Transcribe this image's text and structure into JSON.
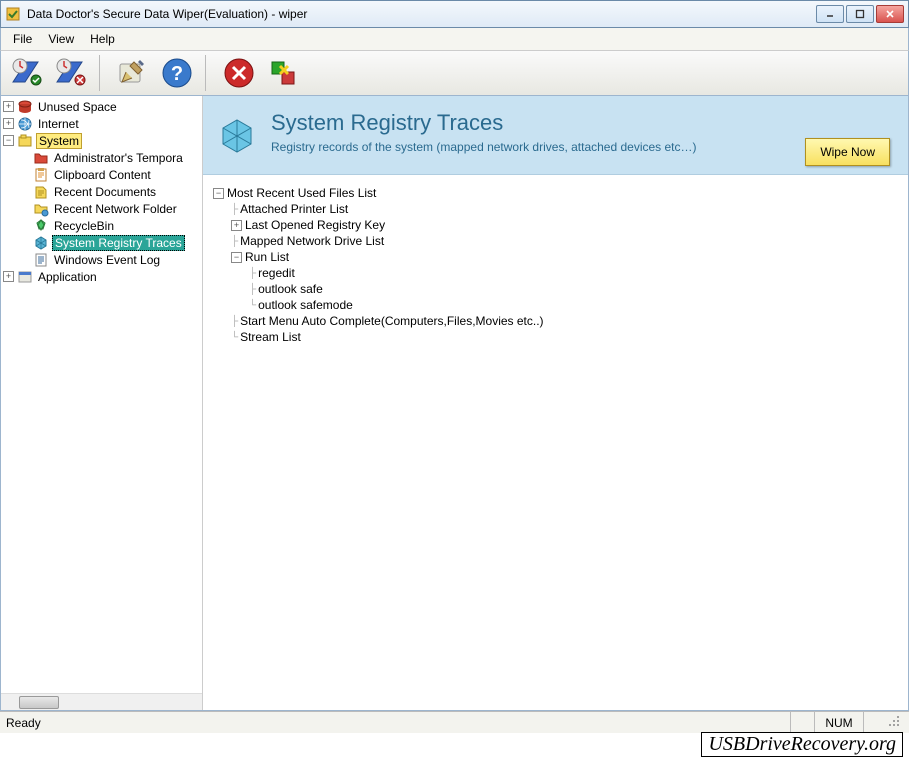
{
  "window": {
    "title": "Data Doctor's Secure Data Wiper(Evaluation) - wiper"
  },
  "menu": {
    "file": "File",
    "view": "View",
    "help": "Help"
  },
  "sidebar": {
    "unused_space": "Unused Space",
    "internet": "Internet",
    "system": "System",
    "system_children": {
      "admin_temp": "Administrator's Tempora",
      "clipboard": "Clipboard Content",
      "recent_docs": "Recent Documents",
      "recent_net": "Recent Network Folder",
      "recyclebin": "RecycleBin",
      "registry_traces": "System Registry Traces",
      "event_log": "Windows Event Log"
    },
    "application": "Application"
  },
  "header": {
    "title": "System Registry Traces",
    "subtitle": "Registry records of the system (mapped network drives, attached devices etc…)",
    "wipe_button": "Wipe Now"
  },
  "detail": {
    "mru": "Most Recent Used Files List",
    "printer": "Attached Printer List",
    "last_reg": "Last Opened Registry Key",
    "mapped_drive": "Mapped Network Drive List",
    "run_list": "Run List",
    "run_children": {
      "regedit": "regedit",
      "outlook_safe": "outlook safe",
      "outlook_safemode": "outlook safemode"
    },
    "start_menu": "Start Menu Auto Complete(Computers,Files,Movies etc..)",
    "stream": "Stream List"
  },
  "status": {
    "ready": "Ready",
    "num": "NUM"
  },
  "watermark": "USBDriveRecovery.org"
}
